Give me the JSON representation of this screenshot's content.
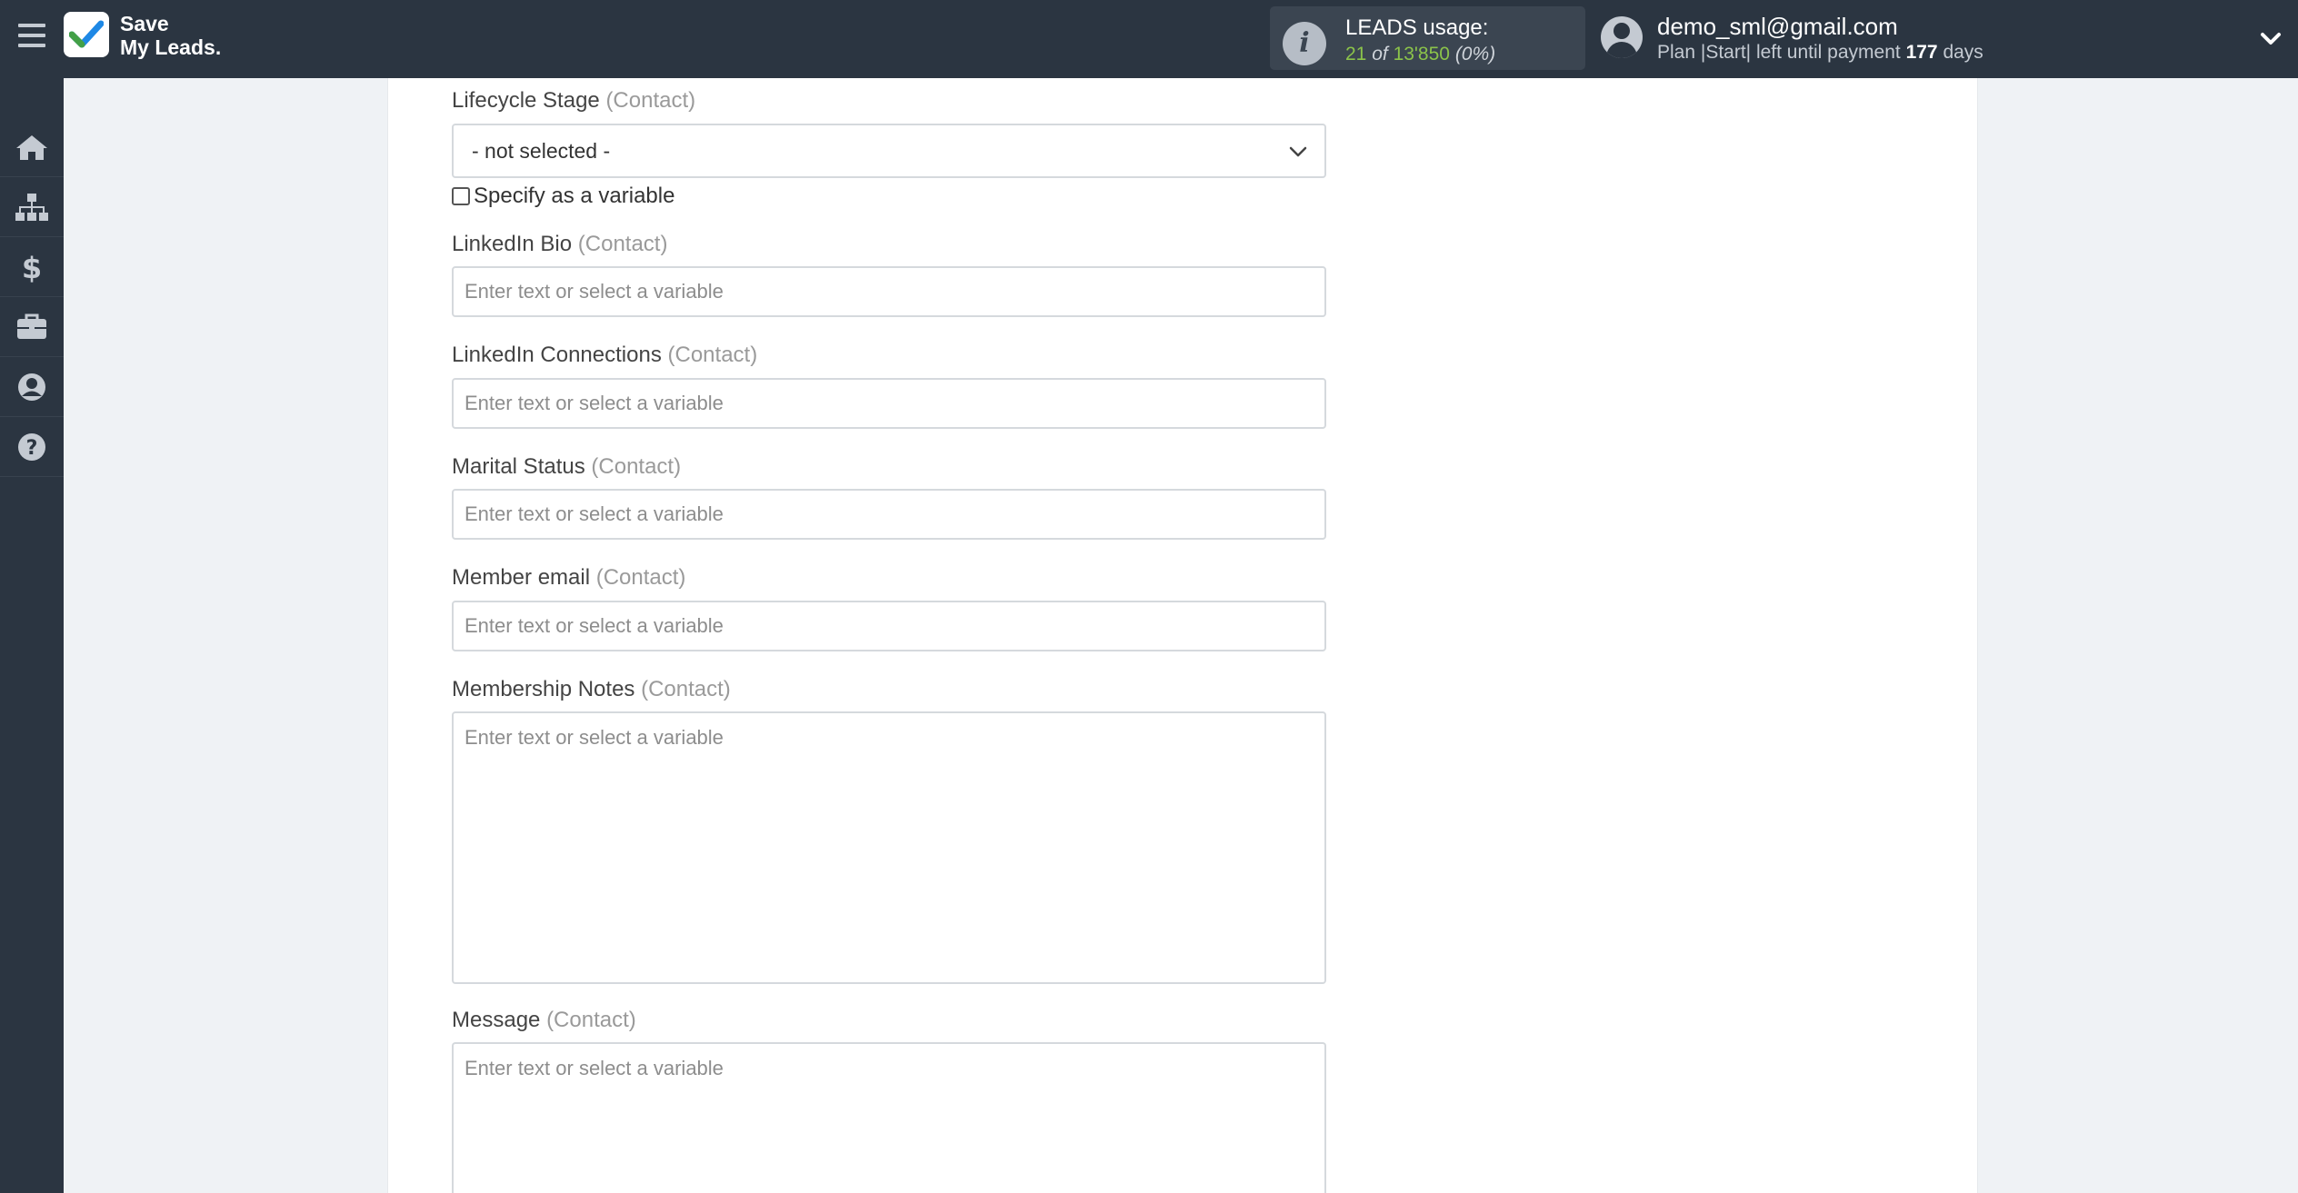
{
  "header": {
    "brand_line1": "Save",
    "brand_line2": "My Leads.",
    "usage_title": "LEADS usage:",
    "usage_used": "21",
    "usage_of": "of",
    "usage_total": "13'850",
    "usage_percent": "(0%)",
    "user_email": "demo_sml@gmail.com",
    "plan_prefix": "Plan |Start| left until payment",
    "plan_days": "177",
    "plan_suffix": "days"
  },
  "sidebar": {
    "icons": [
      "home-icon",
      "sitemap-icon",
      "dollar-icon",
      "briefcase-icon",
      "user-circle-icon",
      "question-circle-icon"
    ]
  },
  "form": {
    "lifecycle_label": "Lifecycle Stage",
    "lifecycle_sub": "(Contact)",
    "lifecycle_value": "- not selected -",
    "specify_variable": "Specify as a variable",
    "placeholder": "Enter text or select a variable",
    "fields": [
      {
        "label": "LinkedIn Bio",
        "sub": "(Contact)"
      },
      {
        "label": "LinkedIn Connections",
        "sub": "(Contact)"
      },
      {
        "label": "Marital Status",
        "sub": "(Contact)"
      },
      {
        "label": "Member email",
        "sub": "(Contact)"
      },
      {
        "label": "Membership Notes",
        "sub": "(Contact)"
      },
      {
        "label": "Message",
        "sub": "(Contact)"
      }
    ]
  },
  "colors": {
    "topbar": "#2b3541",
    "accent_green": "#8bc34a",
    "background": "#eff2f5"
  }
}
